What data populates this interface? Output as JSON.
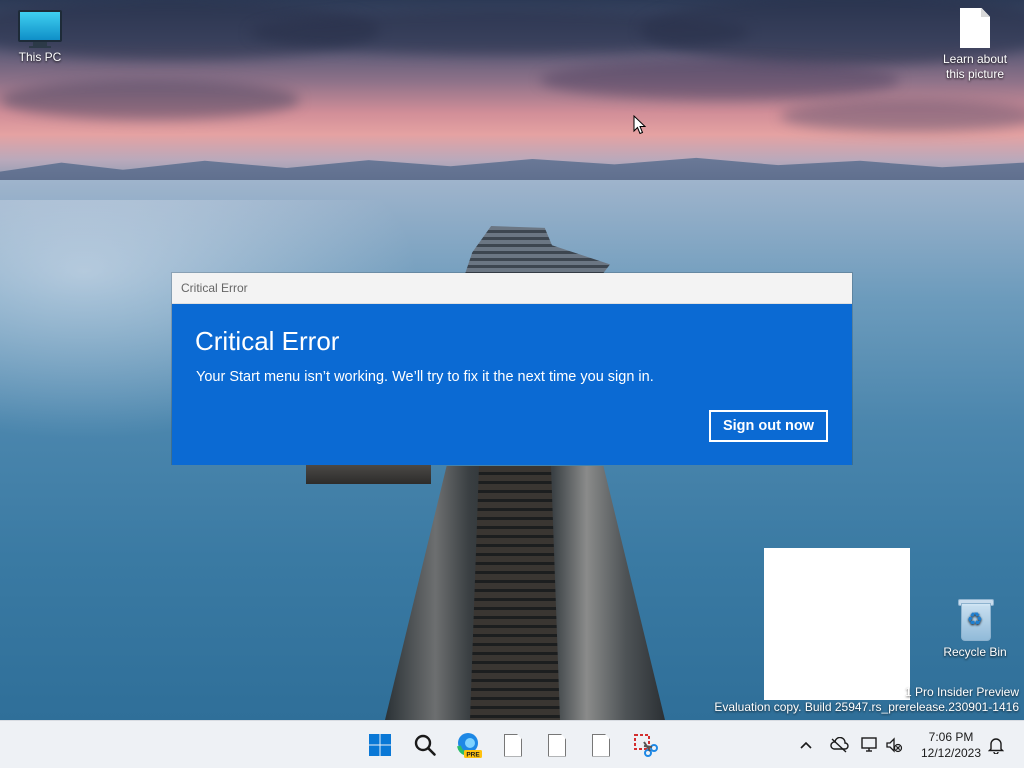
{
  "desktop": {
    "icons": [
      {
        "label": "This PC"
      },
      {
        "label": "Learn about this picture"
      },
      {
        "label": "Recycle Bin"
      }
    ],
    "watermark": {
      "line1": "1 Pro Insider Preview",
      "line2": "Evaluation copy. Build 25947.rs_prerelease.230901-1416"
    }
  },
  "dialog": {
    "window_title": "Critical Error",
    "heading": "Critical Error",
    "message": "Your Start menu isn’t working. We’ll try to fix it the next time you sign in.",
    "button_label": "Sign out now"
  },
  "taskbar": {
    "items": [
      {
        "name": "start",
        "icon": "windows-logo-icon"
      },
      {
        "name": "search",
        "icon": "search-icon"
      },
      {
        "name": "edge-preview",
        "icon": "edge-pre-icon",
        "badge": "PRE"
      },
      {
        "name": "file-1",
        "icon": "file-icon"
      },
      {
        "name": "file-2",
        "icon": "file-icon"
      },
      {
        "name": "file-3",
        "icon": "file-icon"
      },
      {
        "name": "snipping-tool",
        "icon": "snipping-tool-icon"
      }
    ],
    "tray": {
      "icons": [
        "chevron-up-icon",
        "onedrive-offline-icon",
        "network-icon",
        "volume-muted-icon"
      ],
      "time": "7:06 PM",
      "date": "12/12/2023",
      "notification_icon": "bell-icon"
    }
  },
  "colors": {
    "dialog_blue": "#0b6ad3",
    "taskbar_bg": "#eef1f5"
  }
}
